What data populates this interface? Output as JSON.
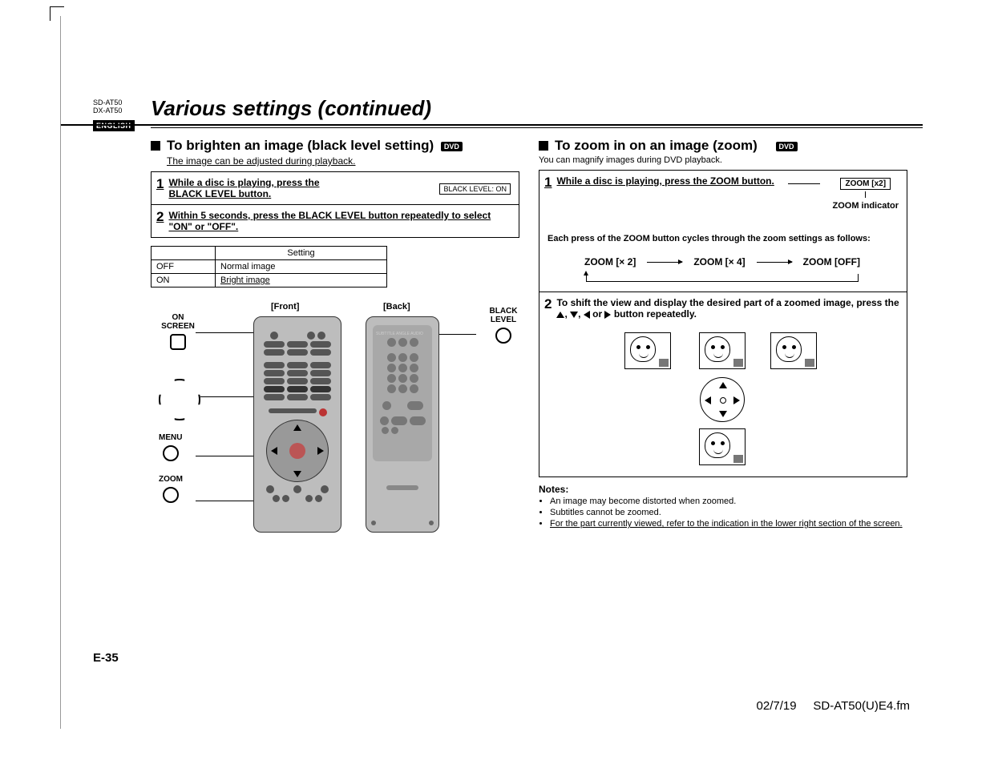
{
  "meta": {
    "model1": "SD-AT50",
    "model2": "DX-AT50",
    "language": "ENGLISH",
    "page_title": "Various settings (continued)",
    "page_number": "E-35",
    "footer_date": "02/7/19",
    "footer_file": "SD-AT50(U)E4.fm"
  },
  "left": {
    "heading": "To brighten an image (black level setting)",
    "media_badge": "DVD",
    "subline": "The image can be adjusted during playback.",
    "step1": "While a disc is playing, press the BLACK LEVEL button.",
    "step1_display": "BLACK LEVEL:   ON",
    "step2": "Within 5 seconds, press the BLACK LEVEL button repeatedly to select \"ON\" or \"OFF\".",
    "table": {
      "header": "Setting",
      "rows": [
        {
          "key": "OFF",
          "val": "Normal image"
        },
        {
          "key": "ON",
          "val": "Bright image"
        }
      ]
    },
    "remote": {
      "front_label": "[Front]",
      "back_label": "[Back]",
      "on_screen": "ON SCREEN",
      "menu": "MENU",
      "zoom": "ZOOM",
      "black_level": "BLACK LEVEL"
    }
  },
  "right": {
    "heading": "To zoom in on an image (zoom)",
    "media_badge": "DVD",
    "subline": "You can magnify images during DVD playback.",
    "step1": "While a disc is playing, press the ZOOM button.",
    "zoom_indicator_box": "ZOOM [x2]",
    "zoom_indicator_label": "ZOOM indicator",
    "cycle_intro": "Each press of the ZOOM button cycles through the zoom settings as follows:",
    "cycle": {
      "a": "ZOOM [× 2]",
      "b": "ZOOM [× 4]",
      "c": "ZOOM [OFF]"
    },
    "step2_a": "To shift the view and display the desired part of a zoomed image, press the ",
    "step2_b": " button repeatedly.",
    "arrow_sep_or": " or ",
    "notes_head": "Notes:",
    "notes": [
      "An image may become distorted when zoomed.",
      "Subtitles cannot be zoomed.",
      "For the part currently viewed, refer to the indication in the lower right section of the screen."
    ]
  }
}
